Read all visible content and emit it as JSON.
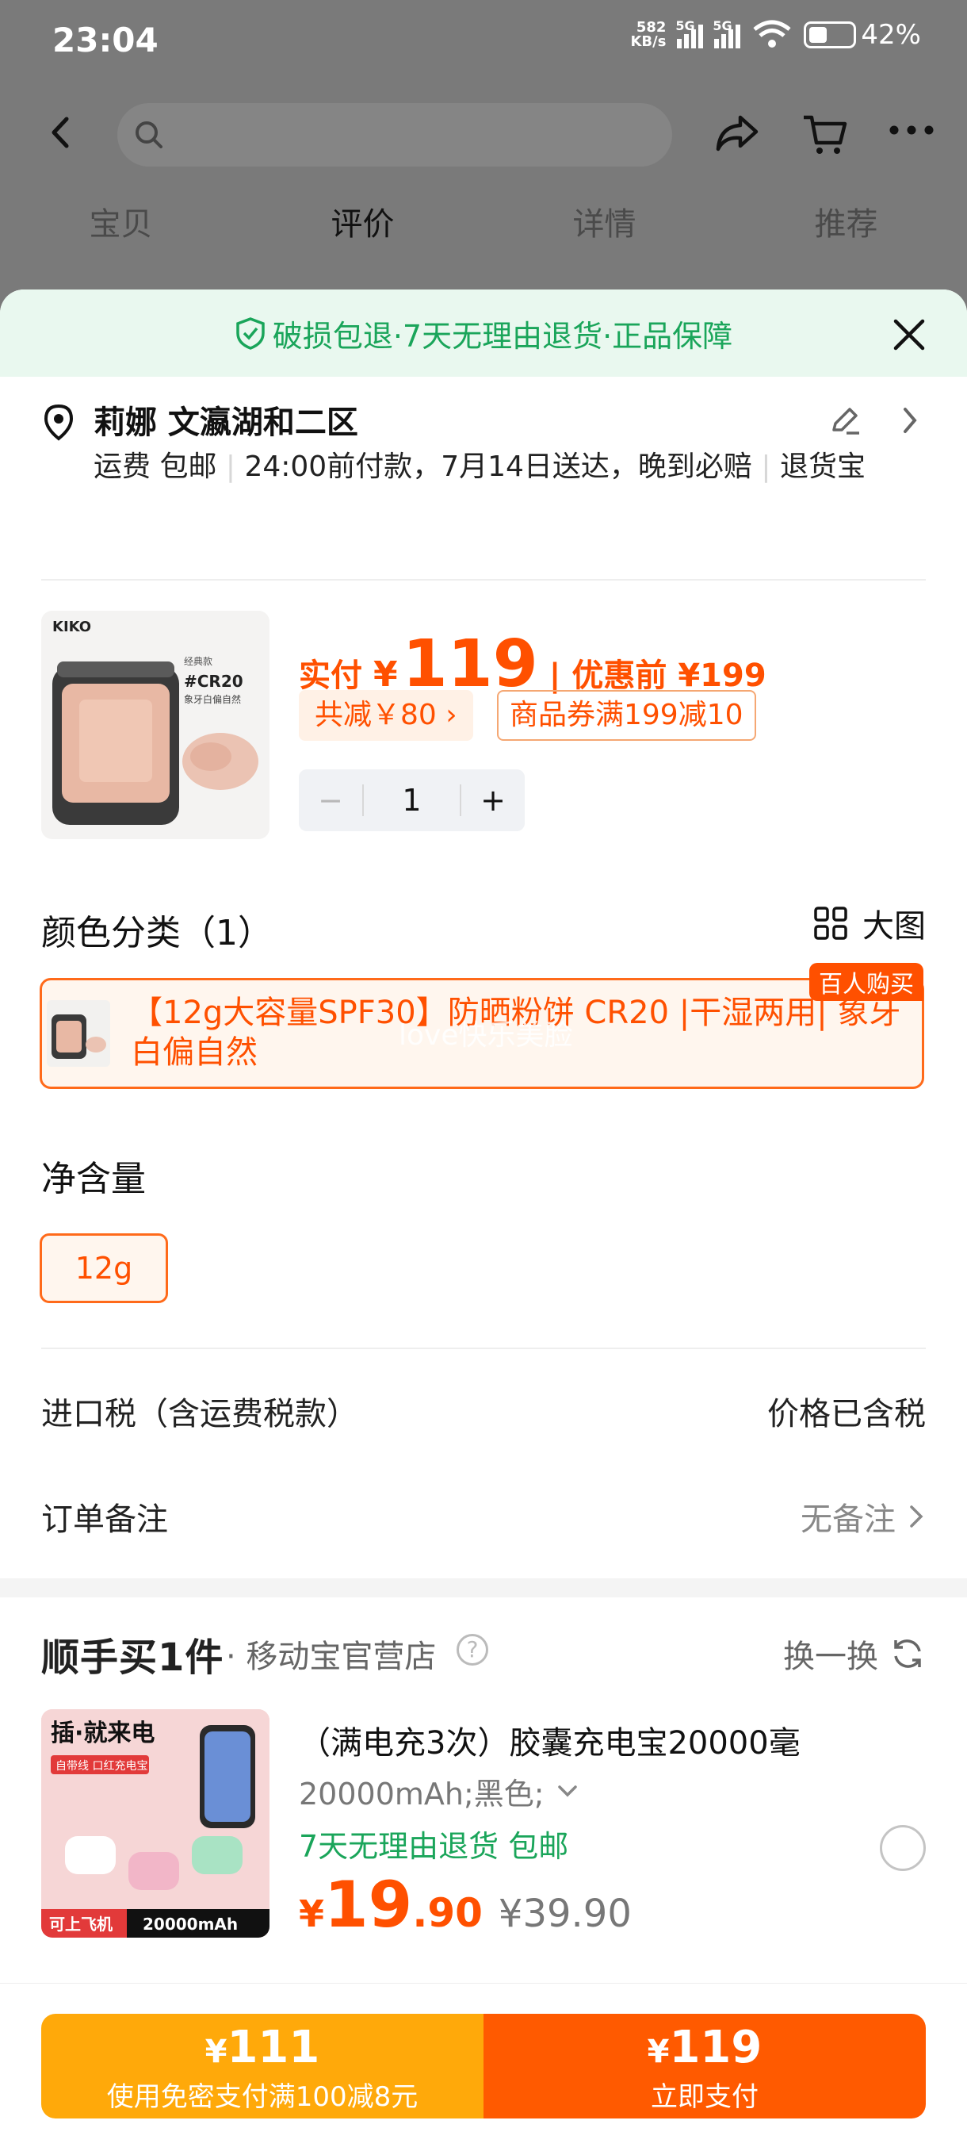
{
  "status": {
    "time": "23:04",
    "net_speed_top": "582",
    "net_speed_bottom": "KB/s",
    "sig1": "5G",
    "sig2": "5G",
    "wifi": "6",
    "battery": "42%"
  },
  "bg": {
    "tabs": [
      "宝贝",
      "评价",
      "详情",
      "推荐"
    ],
    "active_tab": 1
  },
  "banner": {
    "text": "破损包退·7天无理由退货·正品保障"
  },
  "address": {
    "name": "莉娜 文瀛湖和二区",
    "shipping": [
      "运费 包邮",
      "24:00前付款，7月14日送达，晚到必赔",
      "退货宝"
    ]
  },
  "product": {
    "thumb": {
      "brand": "KIKO",
      "shade_label": "经典款",
      "shade": "#CR20",
      "shade_desc": "象牙白偏自然"
    },
    "paid_label": "实付",
    "currency": "¥",
    "price": "119",
    "orig_label": "优惠前",
    "orig_price": "¥199",
    "discount": "共减￥80",
    "coupon": "商品券满199减10",
    "quantity": "1",
    "minus": "−",
    "plus": "+"
  },
  "color": {
    "heading": "颜色分类（1）",
    "big_view": "大图",
    "variant_text": "【12g大容量SPF30】防晒粉饼 CR20 |干湿两用| 象牙白偏自然",
    "badge": "百人购买",
    "watermark": "love快乐美脸"
  },
  "net": {
    "heading": "净含量",
    "option": "12g"
  },
  "tax": {
    "label": "进口税（含运费税款）",
    "value": "价格已含税"
  },
  "note": {
    "label": "订单备注",
    "value": "无备注"
  },
  "bundle": {
    "logo": "顺手买1件",
    "store": "· 移动宝官营店",
    "help": "?",
    "swap": "换一换",
    "item": {
      "thumb_title": "插·就来电",
      "thumb_tag": "自带线 口红充电宝",
      "thumb_badge1": "可上飞机",
      "thumb_badge2": "20000mAh",
      "title": "（满电充3次）胶囊充电宝20000毫",
      "spec": "20000mAh;黑色;",
      "tags": "7天无理由退货  包邮",
      "currency": "¥",
      "price_int": "19",
      "price_dec": ".90",
      "orig": "¥39.90"
    }
  },
  "pay": {
    "left_currency": "¥",
    "left_amount": "111",
    "left_sub": "使用免密支付满100减8元",
    "right_currency": "¥",
    "right_amount": "119",
    "right_sub": "立即支付"
  },
  "colors": {
    "accent": "#ff5000",
    "green": "#1aa55a",
    "pay_left": "#ffa90a",
    "pay_right": "#ff5a00"
  }
}
